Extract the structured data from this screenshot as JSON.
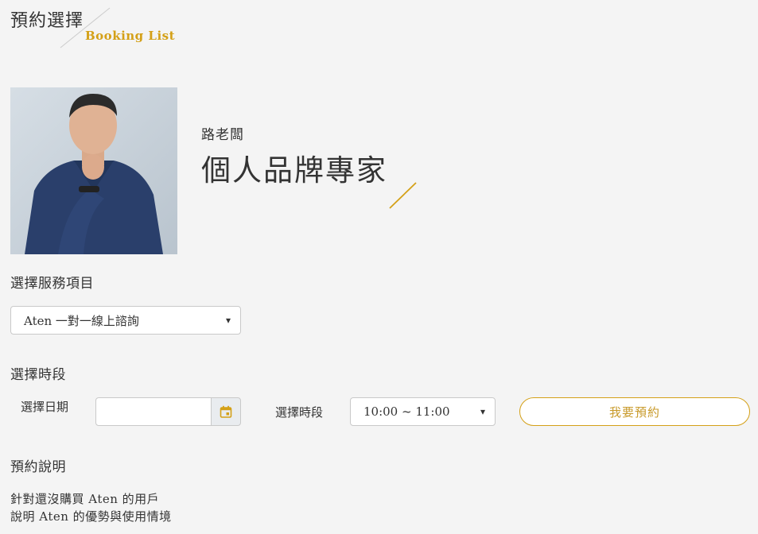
{
  "header": {
    "title": "預約選擇",
    "subtitle": "Booking List"
  },
  "expert": {
    "name": "路老闆",
    "title": "個人品牌專家"
  },
  "service": {
    "section_label": "選擇服務項目",
    "selected": "Aten 一對一線上諮詢"
  },
  "timeslot": {
    "section_label": "選擇時段",
    "date_label": "選擇日期",
    "date_value": "",
    "time_label": "選擇時段",
    "time_selected": "10:00 ~ 11:00",
    "book_button": "我要預約"
  },
  "description": {
    "section_label": "預約說明",
    "lines": [
      "針對還沒購買 Aten 的用戶",
      "說明 Aten 的優勢與使用情境"
    ]
  },
  "icons": {
    "calendar": "calendar-icon",
    "dropdown": "chevron-down-icon"
  },
  "colors": {
    "accent": "#d4a017",
    "background": "#f4f4f4",
    "text": "#333333"
  }
}
